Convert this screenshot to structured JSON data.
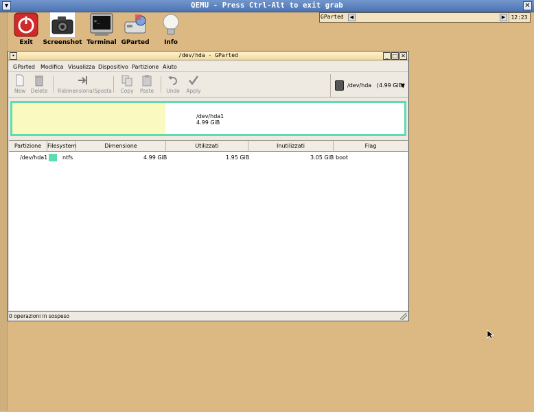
{
  "qemu": {
    "title": "QEMU - Press Ctrl-Alt to exit grab"
  },
  "launchers": [
    {
      "label": "Exit",
      "icon": "power-icon"
    },
    {
      "label": "Screenshot",
      "icon": "camera-icon"
    },
    {
      "label": "Terminal",
      "icon": "terminal-icon"
    },
    {
      "label": "GParted",
      "icon": "gparted-icon"
    },
    {
      "label": "Info",
      "icon": "lightbulb-icon"
    }
  ],
  "panel": {
    "app_name": "GParted",
    "clock": "12:23"
  },
  "window": {
    "title": "/dev/hda - GParted"
  },
  "menu": [
    "GParted",
    "Modifica",
    "Visualizza",
    "Dispositivo",
    "Partizione",
    "Aiuto"
  ],
  "toolbar": {
    "new": "New",
    "delete": "Delete",
    "resize": "Ridimensiona/Sposta",
    "copy": "Copy",
    "paste": "Paste",
    "undo": "Undo",
    "apply": "Apply"
  },
  "device": {
    "name": "/dev/hda",
    "size": "(4.99 GiB)"
  },
  "partition_map": {
    "name": "/dev/hda1",
    "size": "4.99 GiB",
    "used_fraction": 0.39,
    "fs_color": "#5ddcb0"
  },
  "table": {
    "headers": [
      "Partizione",
      "Filesystem",
      "Dimensione",
      "Utilizzati",
      "Inutilizzati",
      "Flag"
    ],
    "rows": [
      {
        "partition": "/dev/hda1",
        "filesystem": "ntfs",
        "size": "4.99 GiB",
        "used": "1.95 GiB",
        "unused": "3.05 GiB",
        "flag": "boot"
      }
    ]
  },
  "status": {
    "pending": "0 operazioni in sospeso"
  }
}
